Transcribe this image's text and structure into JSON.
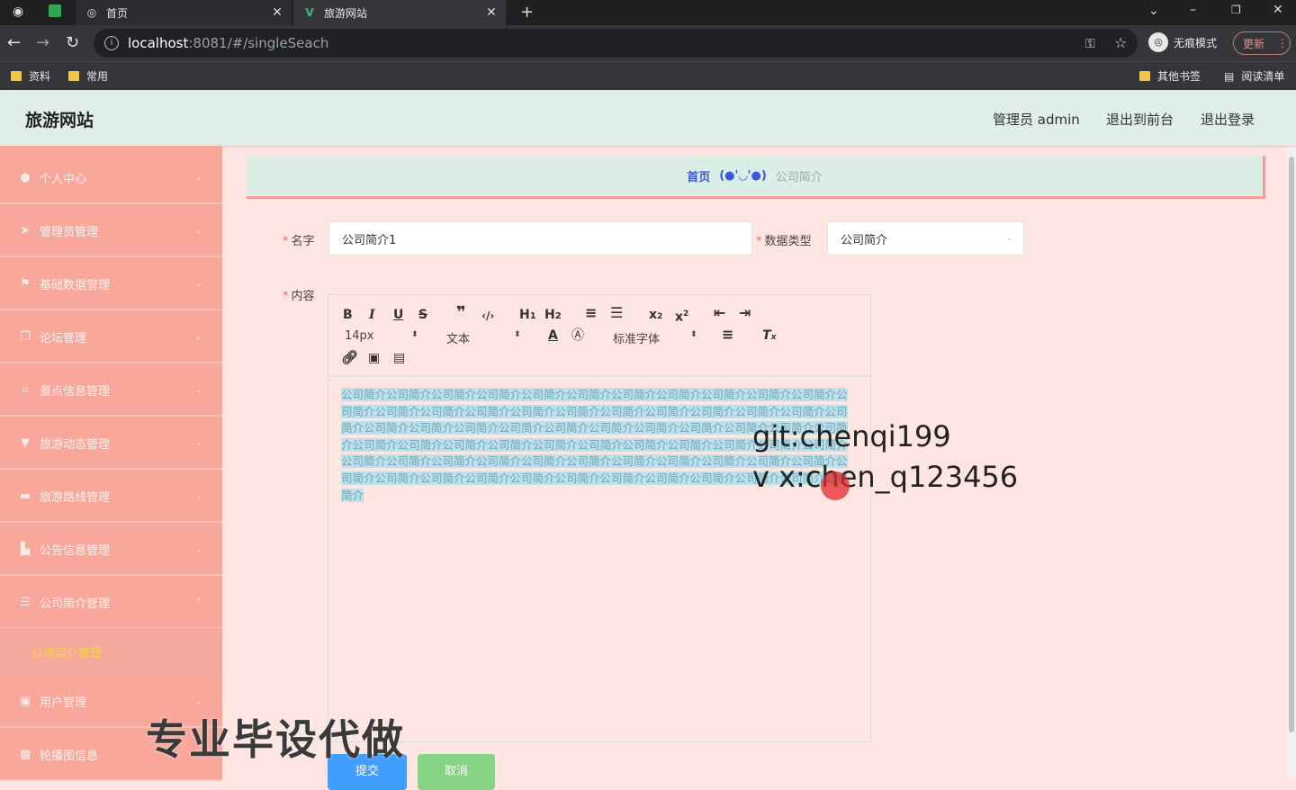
{
  "browser": {
    "tabs": [
      {
        "title": "首页",
        "active": false
      },
      {
        "title": "旅游网站",
        "active": true
      }
    ],
    "url_host": "localhost",
    "url_path": ":8081/#/singleSeach",
    "incognito_label": "无痕模式",
    "update_label": "更新",
    "bookmarks": [
      "资料",
      "常用"
    ],
    "bookmarks_right": [
      "其他书签",
      "阅读清单"
    ]
  },
  "header": {
    "site_title": "旅游网站",
    "admin_label": "管理员 admin",
    "exit_front": "退出到前台",
    "logout": "退出登录"
  },
  "sidebar": {
    "items": [
      {
        "label": "个人中心",
        "icon": "user-icon"
      },
      {
        "label": "管理员管理",
        "icon": "send-icon"
      },
      {
        "label": "基础数据管理",
        "icon": "flag-icon"
      },
      {
        "label": "论坛管理",
        "icon": "copy-icon"
      },
      {
        "label": "景点信息管理",
        "icon": "crop-icon"
      },
      {
        "label": "旅游动态管理",
        "icon": "trophy-icon"
      },
      {
        "label": "旅游路线管理",
        "icon": "message-icon"
      },
      {
        "label": "公告信息管理",
        "icon": "shop-icon"
      },
      {
        "label": "公司简介管理",
        "icon": "list-icon"
      },
      {
        "label": "用户管理",
        "icon": "user-group-icon"
      },
      {
        "label": "轮播图信息",
        "icon": "picture-icon"
      }
    ],
    "active_sub": "公司简介管理"
  },
  "breadcrumb": {
    "home": "首页",
    "separator": "(●'◡'●)",
    "current": "公司简介"
  },
  "form": {
    "name_label": "名字",
    "name_value": "公司简介1",
    "type_label": "数据类型",
    "type_value": "公司简介",
    "content_label": "内容",
    "font_size": "14px",
    "text_style": "文本",
    "font_family": "标准字体",
    "content_text": "公司简介公司简介公司简介公司简介公司简介公司简介公司简介公司简介公司简介公司简介公司简介公司简介公司简介公司简介公司简介公司简介公司简介公司简介公司简介公司简介公司简介公司简介公司简介公司简介公司简介公司简介公司简介公司简介公司简介公司简介公司简介公司简介公司简介公司简介公司简介公司简介公司简介公司简介公司简介公司简介公司简介公司简介公司简介公司简介公司简介公司简介公司简介公司简介公司简介公司简介公司简介公司简介公司简介公司简介公司简介公司简介公司简介公司简介公司简介公司简介公司简介公司简介公司简介公司简介公司简介公司简介公司简介公司简介",
    "submit": "提交",
    "cancel": "取消"
  },
  "overlay": {
    "line1": "git:chenqi199",
    "line2": "v x:chen_q123456",
    "watermark": "专业毕设代做"
  },
  "colors": {
    "sidebar_bg": "#f9a79b",
    "header_bg": "#dfeee6",
    "active_sub": "#f5d34a",
    "submit_btn": "#409eff",
    "cancel_btn": "#85d383"
  }
}
